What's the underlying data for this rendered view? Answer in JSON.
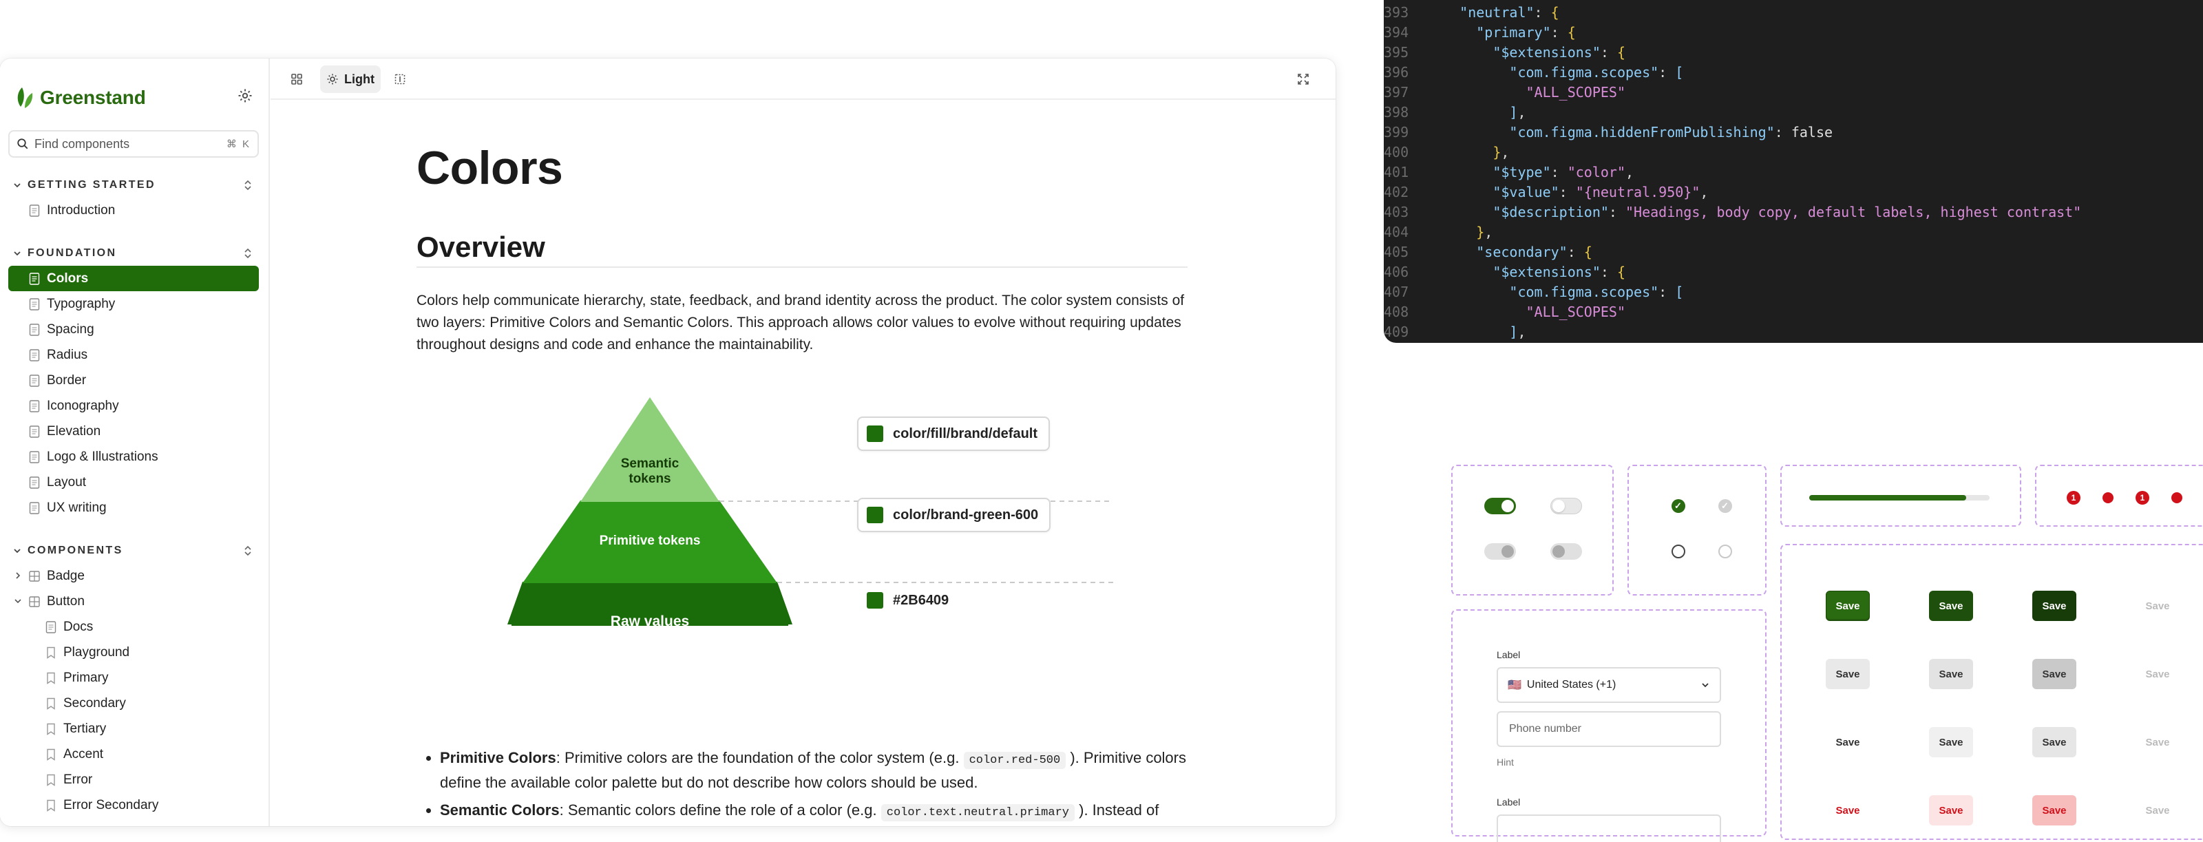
{
  "brand": {
    "name": "Greenstand"
  },
  "search": {
    "placeholder": "Find components",
    "shortcut": "⌘ K"
  },
  "nav": {
    "getting_started": {
      "label": "GETTING STARTED",
      "items": [
        "Introduction"
      ]
    },
    "foundation": {
      "label": "FOUNDATION",
      "items": [
        "Colors",
        "Typography",
        "Spacing",
        "Radius",
        "Border",
        "Iconography",
        "Elevation",
        "Logo & Illustrations",
        "Layout",
        "UX writing"
      ],
      "active": "Colors"
    },
    "components": {
      "label": "COMPONENTS",
      "badge": "Badge",
      "button": "Button",
      "button_children": [
        "Docs",
        "Playground",
        "Primary",
        "Secondary",
        "Tertiary",
        "Accent",
        "Error",
        "Error Secondary"
      ]
    }
  },
  "toolbar": {
    "theme_label": "Light"
  },
  "page": {
    "title": "Colors",
    "overview_heading": "Overview",
    "overview_text": "Colors help communicate hierarchy, state, feedback, and brand identity across the product. The color system consists of two layers: Primitive Colors and Semantic Colors. This approach allows color values to evolve without requiring updates throughout designs and code and enhance the maintainability."
  },
  "pyramid": {
    "top_label_1": "Semantic",
    "top_label_2": "tokens",
    "mid_label": "Primitive tokens",
    "bottom_label": "Raw values",
    "semantic_token": "color/fill/brand/default",
    "primitive_token": "color/brand-green-600",
    "raw_value": "#2B6409",
    "colors": {
      "top": "#8ed07a",
      "mid": "#2f9a1a",
      "bottom": "#1a6b0a",
      "swatch": "#1e6e0c"
    }
  },
  "bullets": {
    "primitive_term": "Primitive Colors",
    "primitive_text_1": ": Primitive colors are the foundation of the color system (e.g.",
    "primitive_code": "color.red-500",
    "primitive_text_2": "). Primitive colors define the available color palette but do not describe how colors should be used.",
    "semantic_term": "Semantic Colors",
    "semantic_text_1": ": Semantic colors define the role of a color (e.g.",
    "semantic_code": "color.text.neutral.primary",
    "semantic_text_2": "). Instead of"
  },
  "code": {
    "lines": [
      {
        "n": "393",
        "t": "    \"neutral\": {"
      },
      {
        "n": "394",
        "t": "      \"primary\": {"
      },
      {
        "n": "395",
        "t": "        \"$extensions\": {"
      },
      {
        "n": "396",
        "t": "          \"com.figma.scopes\": ["
      },
      {
        "n": "397",
        "t": "            \"ALL_SCOPES\""
      },
      {
        "n": "398",
        "t": "          ],"
      },
      {
        "n": "399",
        "t": "          \"com.figma.hiddenFromPublishing\": false"
      },
      {
        "n": "400",
        "t": "        },"
      },
      {
        "n": "401",
        "t": "        \"$type\": \"color\","
      },
      {
        "n": "402",
        "t": "        \"$value\": \"{neutral.950}\","
      },
      {
        "n": "403",
        "t": "        \"$description\": \"Headings, body copy, default labels, highest contrast\""
      },
      {
        "n": "404",
        "t": "      },"
      },
      {
        "n": "405",
        "t": "      \"secondary\": {"
      },
      {
        "n": "406",
        "t": "        \"$extensions\": {"
      },
      {
        "n": "407",
        "t": "          \"com.figma.scopes\": ["
      },
      {
        "n": "408",
        "t": "            \"ALL_SCOPES\""
      },
      {
        "n": "409",
        "t": "          ],"
      }
    ]
  },
  "gallery": {
    "label": "Label",
    "country": "United States (+1)",
    "phone_placeholder": "Phone number",
    "hint": "Hint",
    "label_2": "Label",
    "save": "Save"
  }
}
